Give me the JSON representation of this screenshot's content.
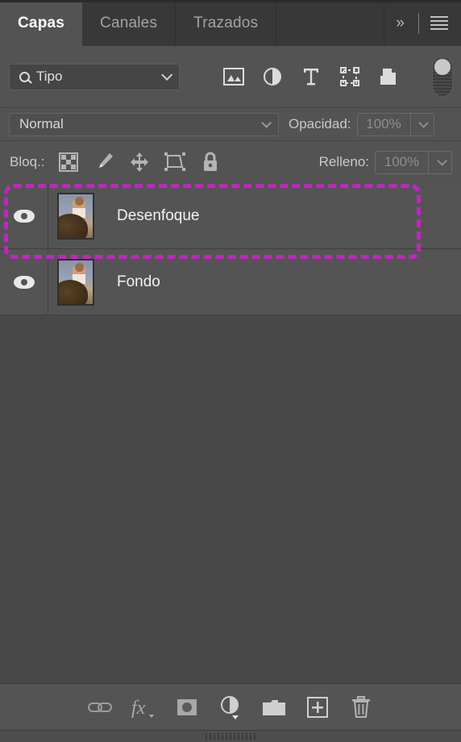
{
  "panel": {
    "tabs": [
      {
        "label": "Capas",
        "active": true
      },
      {
        "label": "Canales",
        "active": false
      },
      {
        "label": "Trazados",
        "active": false
      }
    ],
    "collapse_label": "»",
    "menu_label": "panel-menu"
  },
  "filter": {
    "type_label": "Tipo",
    "icons": [
      "pixel-layer-filter-icon",
      "adjustment-layer-filter-icon",
      "type-layer-filter-icon",
      "shape-layer-filter-icon",
      "smart-object-filter-icon"
    ],
    "toggle_state": "off"
  },
  "blend": {
    "mode": "Normal",
    "opacity_label": "Opacidad:",
    "opacity_value": "100%"
  },
  "lock": {
    "label": "Bloq.:",
    "icons": [
      "lock-transparency-icon",
      "lock-image-icon",
      "lock-position-icon",
      "lock-artboard-icon",
      "lock-all-icon"
    ],
    "fill_label": "Relleno:",
    "fill_value": "100%"
  },
  "layers": [
    {
      "name": "Desenfoque",
      "visible": true,
      "selected": false
    },
    {
      "name": "Fondo",
      "visible": true,
      "selected": false
    }
  ],
  "bottom_toolbar": {
    "buttons": [
      {
        "name": "link-layers-button",
        "glyph": "link-icon"
      },
      {
        "name": "layer-style-button",
        "glyph": "fx-icon"
      },
      {
        "name": "add-layer-mask-button",
        "glyph": "mask-icon"
      },
      {
        "name": "new-adjustment-layer-button",
        "glyph": "adjustment-icon"
      },
      {
        "name": "new-group-button",
        "glyph": "folder-icon"
      },
      {
        "name": "new-layer-button",
        "glyph": "plus-square-icon"
      },
      {
        "name": "delete-layer-button",
        "glyph": "trash-icon"
      }
    ]
  },
  "colors": {
    "panel_bg": "#484848",
    "row_bg": "#545454",
    "tabstrip_bg": "#383838",
    "active_tab_bg": "#535353",
    "annotation": "#c026c0",
    "text": "#f2f2f2",
    "dim_text": "#8e8e8e"
  }
}
